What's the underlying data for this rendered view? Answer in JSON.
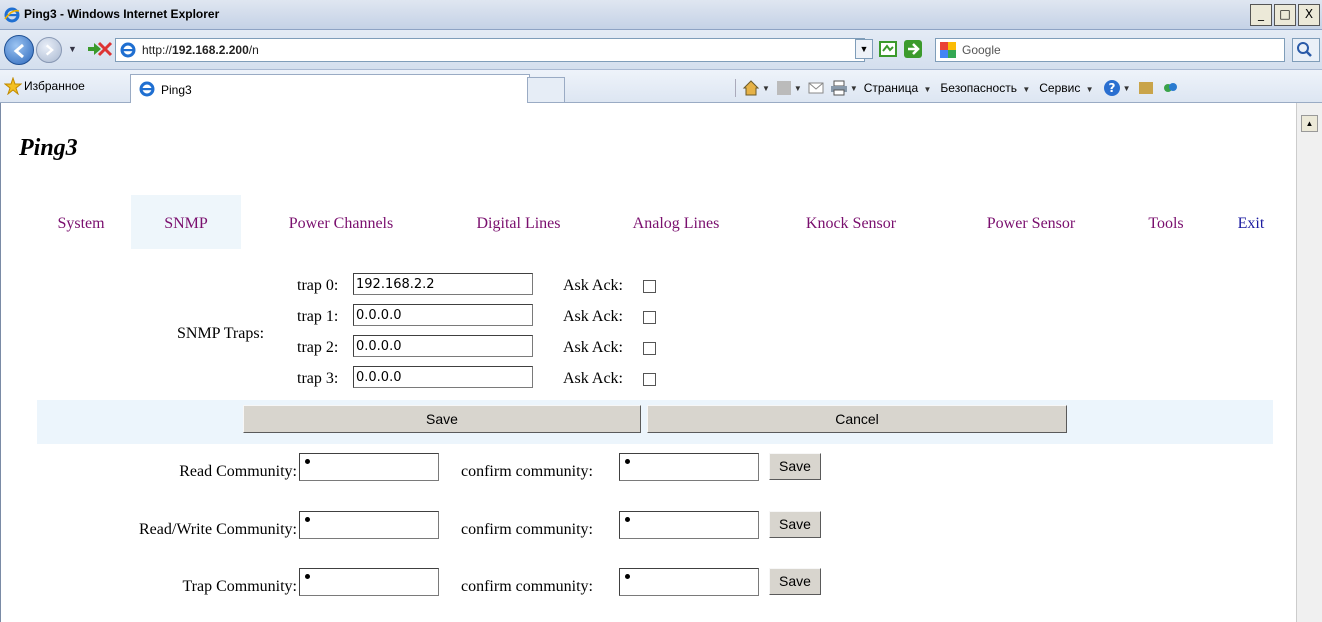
{
  "window": {
    "title": "Ping3 - Windows Internet Explorer",
    "minimize": "_",
    "maximize": "□",
    "close": "X"
  },
  "address": {
    "url_prefix": "http://",
    "url_host": "192.168.2.200",
    "url_path": "/n",
    "search_placeholder": "Google"
  },
  "favorites": {
    "label": "Избранное",
    "tab_label": "Ping3",
    "commands": [
      "Страница",
      "Безопасность",
      "Сервис"
    ]
  },
  "page": {
    "title": "Ping3",
    "nav": [
      "System",
      "SNMP",
      "Power Channels",
      "Digital Lines",
      "Analog Lines",
      "Knock Sensor",
      "Power Sensor",
      "Tools",
      "Exit"
    ],
    "active_tab": "SNMP"
  },
  "snmp": {
    "traps_label": "SNMP Traps:",
    "traps": [
      {
        "label": "trap 0:",
        "ip": "192.168.2.2",
        "ack_label": "Ask Ack:",
        "ack": false
      },
      {
        "label": "trap 1:",
        "ip": "0.0.0.0",
        "ack_label": "Ask Ack:",
        "ack": false
      },
      {
        "label": "trap 2:",
        "ip": "0.0.0.0",
        "ack_label": "Ask Ack:",
        "ack": false
      },
      {
        "label": "trap 3:",
        "ip": "0.0.0.0",
        "ack_label": "Ask Ack:",
        "ack": false
      }
    ],
    "save_label": "Save",
    "cancel_label": "Cancel",
    "communities": [
      {
        "label": "Read Community:",
        "confirm_label": "confirm community:",
        "save_label": "Save"
      },
      {
        "label": "Read/Write Community:",
        "confirm_label": "confirm community:",
        "save_label": "Save"
      },
      {
        "label": "Trap Community:",
        "confirm_label": "confirm community:",
        "save_label": "Save"
      }
    ]
  },
  "colors": {
    "nav_link": "#7a0f6e",
    "exit_link": "#1b1ba0",
    "active_tab_bg": "#eef6fb",
    "save_bar_bg": "#ecf5fc"
  }
}
